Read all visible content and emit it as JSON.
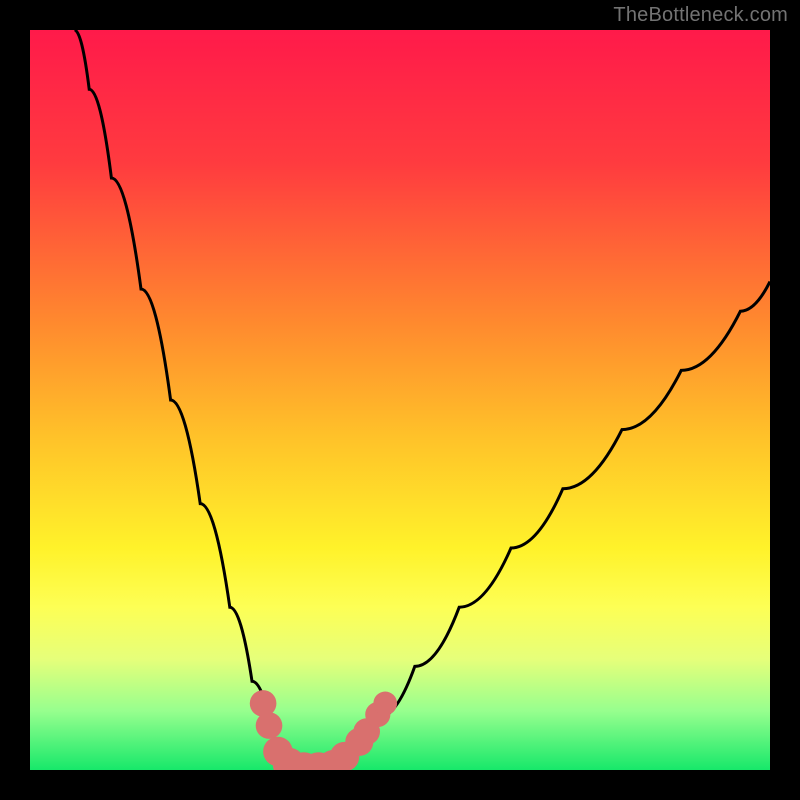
{
  "watermark": "TheBottleneck.com",
  "chart_data": {
    "type": "line",
    "title": "",
    "xlabel": "",
    "ylabel": "",
    "xlim": [
      0,
      100
    ],
    "ylim": [
      0,
      100
    ],
    "gradient_stops": [
      {
        "offset": 0,
        "color": "#ff1a4a"
      },
      {
        "offset": 18,
        "color": "#ff3b3f"
      },
      {
        "offset": 40,
        "color": "#ff8b2e"
      },
      {
        "offset": 55,
        "color": "#ffc229"
      },
      {
        "offset": 70,
        "color": "#fff22a"
      },
      {
        "offset": 78,
        "color": "#fdff55"
      },
      {
        "offset": 85,
        "color": "#e6ff7a"
      },
      {
        "offset": 92,
        "color": "#97ff8e"
      },
      {
        "offset": 100,
        "color": "#17e86a"
      }
    ],
    "series": [
      {
        "name": "bottleneck-curve",
        "color": "#000000",
        "points": [
          {
            "x": 6,
            "y": 100
          },
          {
            "x": 8,
            "y": 92
          },
          {
            "x": 11,
            "y": 80
          },
          {
            "x": 15,
            "y": 65
          },
          {
            "x": 19,
            "y": 50
          },
          {
            "x": 23,
            "y": 36
          },
          {
            "x": 27,
            "y": 22
          },
          {
            "x": 30,
            "y": 12
          },
          {
            "x": 33,
            "y": 4
          },
          {
            "x": 36,
            "y": 0
          },
          {
            "x": 40,
            "y": 0
          },
          {
            "x": 43,
            "y": 2
          },
          {
            "x": 47,
            "y": 7
          },
          {
            "x": 52,
            "y": 14
          },
          {
            "x": 58,
            "y": 22
          },
          {
            "x": 65,
            "y": 30
          },
          {
            "x": 72,
            "y": 38
          },
          {
            "x": 80,
            "y": 46
          },
          {
            "x": 88,
            "y": 54
          },
          {
            "x": 96,
            "y": 62
          },
          {
            "x": 100,
            "y": 66
          }
        ]
      }
    ],
    "markers": [
      {
        "x": 31.5,
        "y": 9,
        "r": 1.8
      },
      {
        "x": 32.3,
        "y": 6,
        "r": 1.8
      },
      {
        "x": 33.5,
        "y": 2.5,
        "r": 2.0
      },
      {
        "x": 35.0,
        "y": 0.8,
        "r": 2.2
      },
      {
        "x": 37.0,
        "y": 0,
        "r": 2.4
      },
      {
        "x": 39.0,
        "y": 0,
        "r": 2.4
      },
      {
        "x": 41.0,
        "y": 0.5,
        "r": 2.2
      },
      {
        "x": 42.5,
        "y": 1.8,
        "r": 2.0
      },
      {
        "x": 44.5,
        "y": 3.8,
        "r": 1.9
      },
      {
        "x": 45.5,
        "y": 5.2,
        "r": 1.8
      },
      {
        "x": 47.0,
        "y": 7.5,
        "r": 1.7
      },
      {
        "x": 48.0,
        "y": 9.0,
        "r": 1.6
      }
    ],
    "marker_color": "#d9706e"
  }
}
